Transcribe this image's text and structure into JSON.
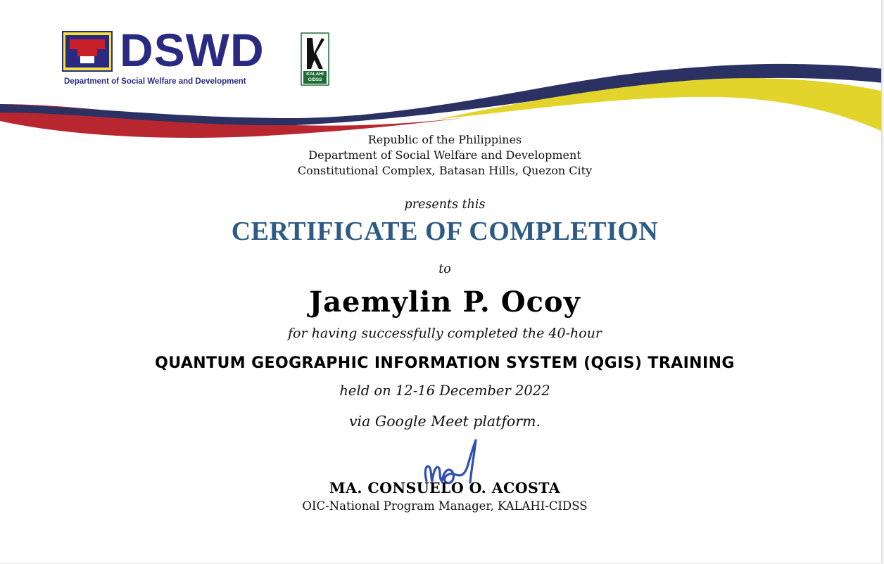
{
  "header": {
    "dswd_logo_text": "DSWD",
    "dswd_logo_subtitle": "Department of Social Welfare and Development",
    "kalahi_logo_text": "KALAHI CIDSS",
    "lines": [
      "Republic of the Philippines",
      "Department of Social Welfare and Development",
      "Constitutional Complex, Batasan Hills, Quezon City"
    ]
  },
  "certificate": {
    "presents": "presents this",
    "title": "CERTIFICATE OF COMPLETION",
    "to": "to",
    "recipient": "Jaemylin P. Ocoy",
    "for_line": "for having successfully completed the 40-hour",
    "course": "QUANTUM GEOGRAPHIC INFORMATION SYSTEM (QGIS) TRAINING",
    "held": "held on 12-16 December 2022",
    "via": "via Google Meet platform."
  },
  "signatory": {
    "name": "MA. CONSUELO O. ACOSTA",
    "position": "OIC-National Program Manager, KALAHI-CIDSS"
  },
  "colors": {
    "navy": "#2b2a83",
    "red": "#b8262f",
    "yellow": "#e6d62a",
    "title_blue": "#2e5a86",
    "signature_blue": "#2f4fb5"
  }
}
